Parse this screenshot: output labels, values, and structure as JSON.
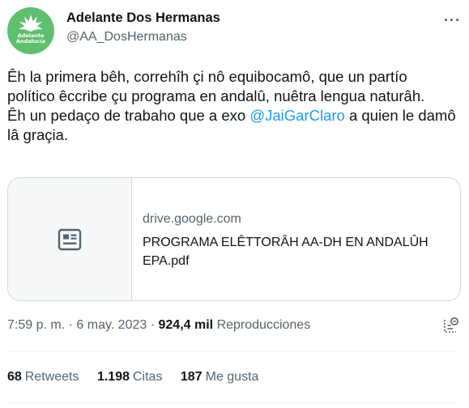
{
  "author": {
    "display_name": "Adelante Dos Hermanas",
    "handle": "@AA_DosHermanas",
    "avatar_text_line1": "Adelante",
    "avatar_text_line2": "Andalucía",
    "avatar_color": "#5fbf6e"
  },
  "more_icon": "more-horizontal-icon",
  "tweet": {
    "paragraph1": "Êh la primera bêh, correhîh çi nô equibocamô, que un partío político êccribe çu programa en andalû, nuêtra lengua naturâh.",
    "paragraph2_before": "Êh un pedaço de trabaho que a exo ",
    "mention": "@JaiGarClaro",
    "paragraph2_after": " a quien le damô lâ graçia."
  },
  "link_card": {
    "icon": "article-icon",
    "domain": "drive.google.com",
    "title": "PROGRAMA ELÊTTORÂH AA-DH EN ANDALÛH EPA.pdf"
  },
  "meta": {
    "time": "7:59 p. m.",
    "separator": "·",
    "date": "6 may. 2023",
    "views_count": "924,4 mil",
    "views_label": "Reproducciones",
    "analytics_icon": "analytics-icon"
  },
  "stats": {
    "retweets_count": "68",
    "retweets_label": "Retweets",
    "quotes_count": "1.198",
    "quotes_label": "Citas",
    "likes_count": "187",
    "likes_label": "Me gusta"
  },
  "colors": {
    "accent": "#1d9bf0",
    "text": "#0f1419",
    "secondary": "#536471",
    "border": "#cfd9de"
  }
}
